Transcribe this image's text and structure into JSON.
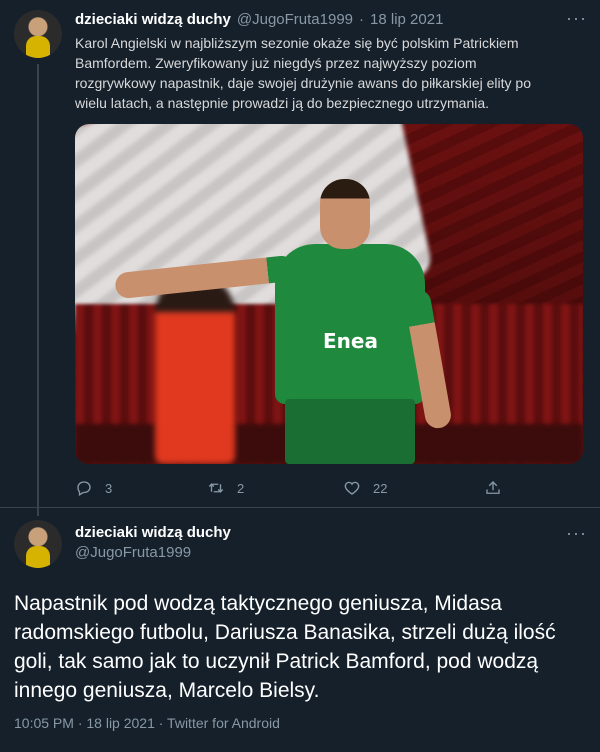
{
  "tweet1": {
    "display_name": "dzieciaki widzą duchy",
    "handle": "@JugoFruta1999",
    "separator": "·",
    "date": "18 lip 2021",
    "more": "···",
    "text": "Karol Angielski w najbliższym sezonie okaże się być polskim Patrickiem Bamfordem. Zweryfikowany już niegdyś przez najwyższy poziom rozgrywkowy napastnik, daje swojej drużynie awans do piłkarskiej elity po wielu latach, a następnie prowadzi ją do bezpiecznego utrzymania.",
    "media_sponsor": "Enea",
    "actions": {
      "reply_count": "3",
      "retweet_count": "2",
      "like_count": "22"
    }
  },
  "tweet2": {
    "display_name": "dzieciaki widzą duchy",
    "handle": "@JugoFruta1999",
    "more": "···",
    "text": "Napastnik pod wodzą taktycznego geniusza, Midasa radomskiego futbolu, Dariusza Banasika, strzeli dużą ilość goli, tak samo jak to uczynił Patrick Bamford, pod wodzą innego geniusza, Marcelo Bielsy.",
    "meta": "10:05 PM · 18 lip 2021 · Twitter for Android"
  },
  "icons": {
    "reply": "reply-icon",
    "retweet": "retweet-icon",
    "like": "like-icon",
    "share": "share-icon"
  },
  "colors": {
    "background": "#15202b",
    "muted": "#8899a6",
    "divider": "#38444d"
  }
}
